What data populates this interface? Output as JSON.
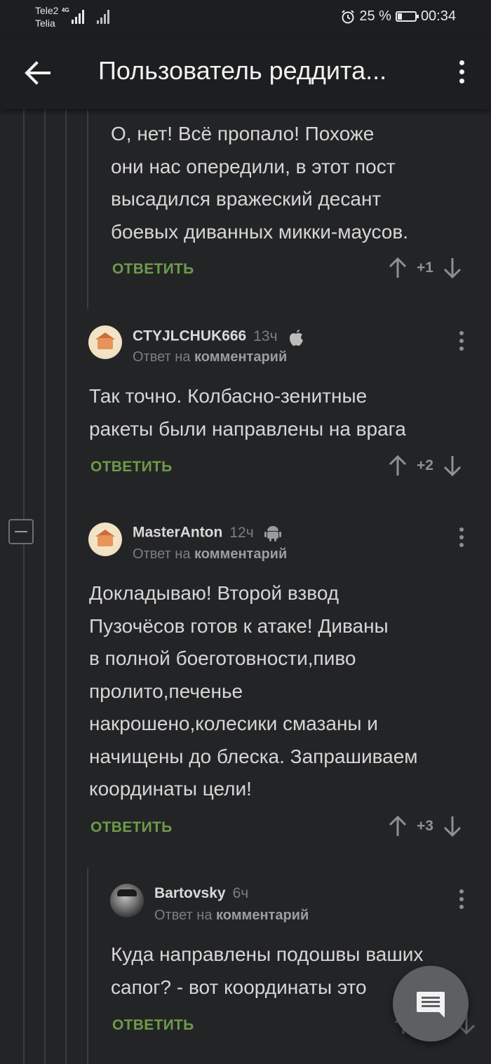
{
  "status": {
    "carrier1": "Tele2",
    "carrier2": "Telia",
    "net": "4G",
    "battery": "25 %",
    "battery_level": 0.25,
    "time": "00:34"
  },
  "appbar": {
    "title": "Пользователь реддита..."
  },
  "comments": [
    {
      "text_lines": [
        "О, нет! Всё пропало! Похоже",
        "они нас опередили, в этот пост",
        "высадился вражеский десант",
        "боевых диванных микки-маусов."
      ],
      "reply": "ОТВЕТИТЬ",
      "score": "+1"
    },
    {
      "user": "CTYJLCHUK666",
      "age": "13ч",
      "platform": "apple-icon",
      "reply_prefix": "Ответ на",
      "reply_target": "комментарий",
      "text_lines": [
        "Так точно. Колбасно-зенитные",
        "ракеты были направлены на врага"
      ],
      "reply": "ОТВЕТИТЬ",
      "score": "+2"
    },
    {
      "user": "MasterAnton",
      "age": "12ч",
      "platform": "android-icon",
      "reply_prefix": "Ответ на",
      "reply_target": "комментарий",
      "text_lines": [
        "Докладываю! Второй взвод",
        "Пузочёсов готов к атаке! Диваны",
        "в полной боеготовности,пиво",
        "пролито,печенье",
        "накрошено,колесики смазаны и",
        "начищены до блеска. Запрашиваем",
        "координаты цели!"
      ],
      "reply": "ОТВЕТИТЬ",
      "score": "+3"
    },
    {
      "user": "Bartovsky",
      "age": "6ч",
      "reply_prefix": "Ответ на",
      "reply_target": "комментарий",
      "text_lines": [
        "Куда направлены подошвы ваших",
        "сапог? - вот координаты это"
      ],
      "reply": "ОТВЕТИТЬ"
    }
  ],
  "colors": {
    "background": "#232426",
    "appbar": "#1d1e20",
    "reply_green": "#6f9a4a"
  }
}
